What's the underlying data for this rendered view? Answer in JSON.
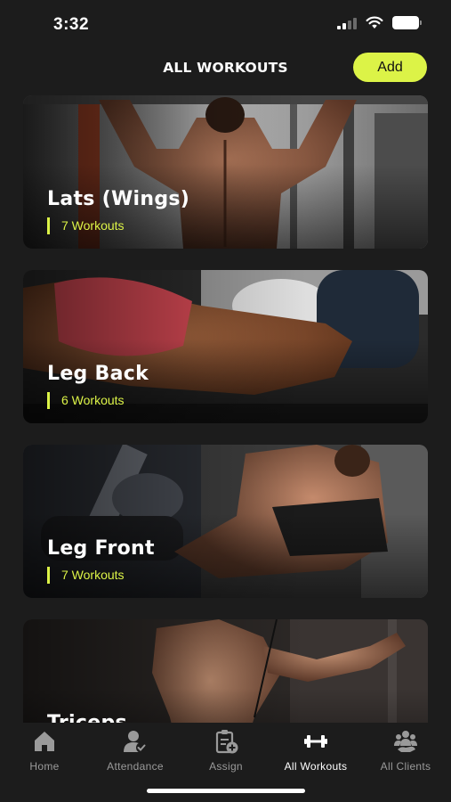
{
  "status_bar": {
    "time": "3:32"
  },
  "header": {
    "title": "ALL WORKOUTS",
    "add_label": "Add"
  },
  "colors": {
    "accent": "#dcf347",
    "background": "#1c1c1c",
    "tab_inactive": "#9a9a9a"
  },
  "workouts": [
    {
      "title": "Lats (Wings)",
      "count": "7 Workouts",
      "image": "back-pullup-photo"
    },
    {
      "title": "Leg Back",
      "count": "6 Workouts",
      "image": "hamstring-curl-photo"
    },
    {
      "title": "Leg Front",
      "count": "7 Workouts",
      "image": "leg-extension-photo"
    },
    {
      "title": "Triceps",
      "count": "",
      "image": "cable-triceps-photo"
    }
  ],
  "tabs": [
    {
      "label": "Home",
      "icon": "home-icon",
      "active": false
    },
    {
      "label": "Attendance",
      "icon": "attendance-icon",
      "active": false
    },
    {
      "label": "Assign",
      "icon": "assign-icon",
      "active": false
    },
    {
      "label": "All Workouts",
      "icon": "dumbbell-icon",
      "active": true
    },
    {
      "label": "All Clients",
      "icon": "clients-icon",
      "active": false
    }
  ]
}
